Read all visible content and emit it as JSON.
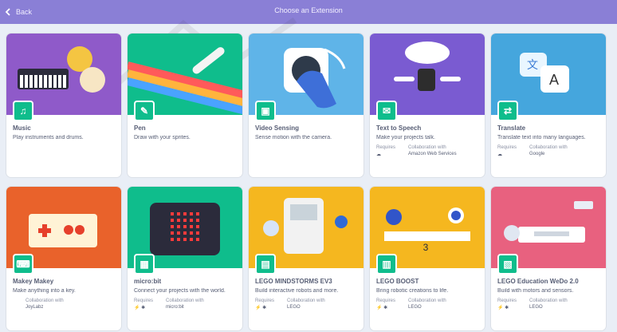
{
  "header": {
    "back_label": "Back",
    "title": "Choose an Extension"
  },
  "extensions": [
    {
      "name": "Music",
      "description": "Play instruments and drums.",
      "art_bg": "#8f5ac9",
      "badge_bg": "#0fbd8c",
      "icon": "music-note-icon"
    },
    {
      "name": "Pen",
      "description": "Draw with your sprites.",
      "art_bg": "#0fbd8c",
      "badge_bg": "#0fbd8c",
      "icon": "pen-icon"
    },
    {
      "name": "Video Sensing",
      "description": "Sense motion with the camera.",
      "art_bg": "#5fb4e8",
      "badge_bg": "#0fbd8c",
      "icon": "video-camera-icon"
    },
    {
      "name": "Text to Speech",
      "description": "Make your projects talk.",
      "art_bg": "#7a5bd1",
      "badge_bg": "#0fbd8c",
      "icon": "speech-bubble-icon",
      "meta": [
        {
          "label": "Requires",
          "value": "☁"
        },
        {
          "label": "Collaboration with",
          "value": "Amazon Web Services"
        }
      ]
    },
    {
      "name": "Translate",
      "description": "Translate text into many languages.",
      "art_bg": "#45a6dd",
      "badge_bg": "#0fbd8c",
      "icon": "translate-icon",
      "meta": [
        {
          "label": "Requires",
          "value": "☁"
        },
        {
          "label": "Collaboration with",
          "value": "Google"
        }
      ]
    },
    {
      "name": "Makey Makey",
      "description": "Make anything into a key.",
      "art_bg": "#e9622b",
      "badge_bg": "#0fbd8c",
      "icon": "keyboard-icon",
      "meta": [
        {
          "label": "",
          "value": ""
        },
        {
          "label": "Collaboration with",
          "value": "JoyLabz"
        }
      ]
    },
    {
      "name": "micro:bit",
      "description": "Connect your projects with the world.",
      "art_bg": "#0fbd8c",
      "badge_bg": "#0fbd8c",
      "icon": "microbit-icon",
      "meta": [
        {
          "label": "Requires",
          "value": "⚡ ✱"
        },
        {
          "label": "Collaboration with",
          "value": "micro:bit"
        }
      ]
    },
    {
      "name": "LEGO MINDSTORMS EV3",
      "description": "Build interactive robots and more.",
      "art_bg": "#f5b71f",
      "badge_bg": "#0fbd8c",
      "icon": "ev3-brick-icon",
      "meta": [
        {
          "label": "Requires",
          "value": "⚡ ✱"
        },
        {
          "label": "Collaboration with",
          "value": "LEGO"
        }
      ]
    },
    {
      "name": "LEGO BOOST",
      "description": "Bring robotic creations to life.",
      "art_bg": "#f5b71f",
      "badge_bg": "#0fbd8c",
      "icon": "boost-hub-icon",
      "meta": [
        {
          "label": "Requires",
          "value": "⚡ ✱"
        },
        {
          "label": "Collaboration with",
          "value": "LEGO"
        }
      ]
    },
    {
      "name": "LEGO Education WeDo 2.0",
      "description": "Build with motors and sensors.",
      "art_bg": "#e8617f",
      "badge_bg": "#0fbd8c",
      "icon": "wedo-hub-icon",
      "meta": [
        {
          "label": "Requires",
          "value": "⚡ ✱"
        },
        {
          "label": "Collaboration with",
          "value": "LEGO"
        }
      ]
    }
  ]
}
